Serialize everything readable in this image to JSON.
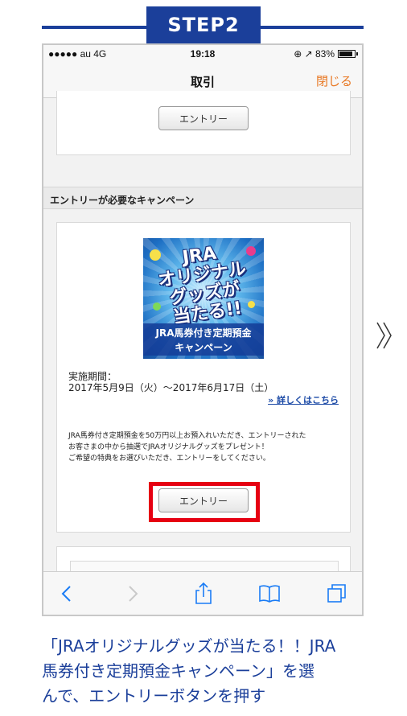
{
  "step": {
    "label": "STEP2"
  },
  "status_bar": {
    "signal": "●●●●● au 4G",
    "time": "19:18",
    "battery": "⊕ ↗ 83%"
  },
  "nav": {
    "title": "取引",
    "close_label": "閉じる"
  },
  "top_card": {
    "entry_label": "エントリー"
  },
  "section": {
    "heading": "エントリーが必要なキャンペーン"
  },
  "campaign": {
    "banner": {
      "line1": "JRA",
      "line2": "オリジナル",
      "line3": "グッズが",
      "line4": "当たる!!",
      "ribbon1": "JRA馬券付き定期預金",
      "ribbon2": "キャンペーン"
    },
    "period_label": "実施期間：",
    "period_value": "2017年5月9日（火）～2017年6月17日（土）",
    "more_link": "» 詳しくはこちら",
    "desc1": "JRA馬券付き定期預金を50万円以上お預入れいただき、エントリーされた",
    "desc2": "お客さまの中から抽選でJRAオリジナルグッズをプレゼント！",
    "desc3": "ご希望の特典をお選びいただき、エントリーをしてください。",
    "entry_label": "エントリー"
  },
  "toolbar": {
    "icons": [
      "back-icon",
      "forward-icon",
      "share-icon",
      "bookmarks-icon",
      "tabs-icon"
    ]
  },
  "caption": {
    "line1": "「JRAオリジナルグッズが当たる！！JRA",
    "line2": "馬券付き定期預金キャンペーン」を選",
    "line3": "んで、エントリーボタンを押す"
  },
  "colors": {
    "brand_blue": "#1b3f9a",
    "highlight_red": "#e60012",
    "close_orange": "#e87722",
    "link_blue": "#1c4aa6"
  }
}
